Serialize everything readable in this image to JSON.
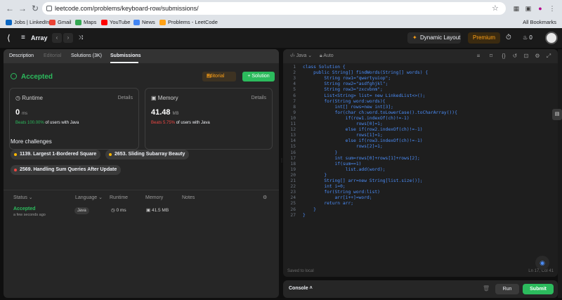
{
  "browser": {
    "url": "leetcode.com/problems/keyboard-row/submissions/",
    "bookmarks": [
      {
        "label": "Jobs | LinkedIn",
        "color": "#0a66c2"
      },
      {
        "label": "Gmail",
        "color": "#ea4335"
      },
      {
        "label": "Maps",
        "color": "#34a853"
      },
      {
        "label": "YouTube",
        "color": "#ff0000"
      },
      {
        "label": "News",
        "color": "#4285f4"
      },
      {
        "label": "Problems - LeetCode",
        "color": "#ffa116"
      }
    ],
    "all_bookmarks": "All Bookmarks"
  },
  "nav": {
    "problem_list": "Array",
    "dynamic_layout": "Dynamic Layout",
    "premium": "Premium",
    "streak": "0"
  },
  "tabs": [
    {
      "label": "Description",
      "state": "normal"
    },
    {
      "label": "Editorial",
      "state": "dim"
    },
    {
      "label": "Solutions (3K)",
      "state": "normal"
    },
    {
      "label": "Submissions",
      "state": "active"
    }
  ],
  "result": {
    "status": "Accepted",
    "editorial_btn": "Editorial",
    "solution_btn": "+ Solution"
  },
  "runtime": {
    "title": "Runtime",
    "details": "Details",
    "value": "0",
    "unit": "ms",
    "beats_pct": "Beats 100.00%",
    "beats_rest": "of users with Java",
    "beats_color": "#2cbb5d"
  },
  "memory": {
    "title": "Memory",
    "details": "Details",
    "value": "41.48",
    "unit": "MB",
    "beats_pct": "Beats 5.75%",
    "beats_rest": "of users with Java",
    "beats_color": "#ef4743"
  },
  "more_challenges": {
    "heading": "More challenges",
    "items": [
      {
        "label": "1139. Largest 1-Bordered Square",
        "dot": "#ffb800"
      },
      {
        "label": "2653. Sliding Subarray Beauty",
        "dot": "#ffb800"
      },
      {
        "label": "2569. Handling Sum Queries After Update",
        "dot": "#ef4743"
      }
    ]
  },
  "table": {
    "headers": [
      "Status",
      "Language",
      "Runtime",
      "Memory",
      "Notes"
    ],
    "rows": [
      {
        "status": "Accepted",
        "time": "a few seconds ago",
        "language": "Java",
        "runtime": "0 ms",
        "memory": "41.5 MB"
      }
    ]
  },
  "editor": {
    "language": "Java",
    "mode": "Auto",
    "saved": "Saved to local",
    "cursor": "Ln 17, Col 41",
    "lines": [
      "class Solution {",
      "    public String[] findWords(String[] words) {",
      "        String row1=\"qwertyuiop\";",
      "        String row2=\"asdfghjkl\";",
      "        String row3=\"zxcvbnm\";",
      "        List<String> list= new LinkedList<>();",
      "        for(String word:words){",
      "            int[] rows=new int[3];",
      "            for(char ch:word.toLowerCase().toCharArray()){",
      "                if(row1.indexOf(ch)!=-1)",
      "                    rows[0]=1;",
      "                else if(row2.indexOf(ch)!=-1)",
      "                    rows[1]=1;",
      "                else if(row3.indexOf(ch)!=-1)",
      "                    rows[2]=1;",
      "            }",
      "            int sum=rows[0]+rows[1]+rows[2];",
      "            if(sum==1)",
      "                list.add(word);",
      "        }",
      "        String[] arr=new String[list.size()];",
      "        int i=0;",
      "        for(String word:list)",
      "            arr[i++]=word;",
      "        return arr;",
      "    }",
      "}"
    ]
  },
  "console": {
    "label": "Console",
    "run": "Run",
    "submit": "Submit"
  }
}
